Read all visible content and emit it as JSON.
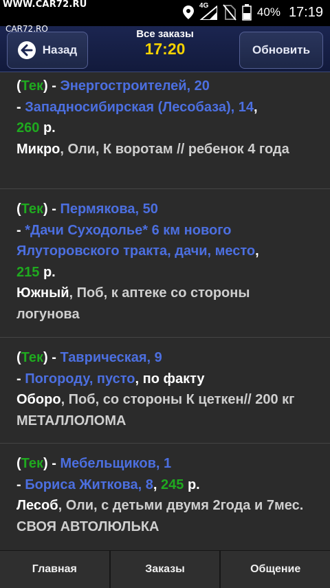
{
  "status_bar": {
    "watermark": "WWW.CAR72.RU",
    "battery": "40%",
    "time": "17:19",
    "network": "4G",
    "icons": [
      "location-icon",
      "signal-icon",
      "no-sim-icon",
      "battery-icon"
    ]
  },
  "toolbar": {
    "logo": "CAR72.RO",
    "back_label": "Назад",
    "title": "Все заказы",
    "clock": "17:20",
    "refresh_label": "Обновить"
  },
  "orders": [
    {
      "tag": "Тек",
      "from": "Энергостроителей, 20",
      "to": "Западносибирская (Лесобаза), 14",
      "to_extra": "",
      "price": "260",
      "currency": "р.",
      "district": "Микро",
      "note": ", Оли, К воротам // ребенок 4 года"
    },
    {
      "tag": "Тек",
      "from": "Пермякова, 50",
      "to": "*Дачи Суходолье* 6 км нового Ялуторовского тракта, дачи, место",
      "to_extra": "",
      "price": "215",
      "currency": "р.",
      "district": "Южный",
      "note": ", Поб, к аптеке со стороны логунова"
    },
    {
      "tag": "Тек",
      "from": "Таврическая, 9",
      "to": "Погороду, пусто",
      "to_extra": ", по факту",
      "price": "",
      "currency": "",
      "district": "Оборо",
      "note": ", Поб, со стороны К цеткен// 200 кг МЕТАЛЛОЛОМА"
    },
    {
      "tag": "Тек",
      "from": "Мебельщиков, 1",
      "to": "Бориса Житкова, 8",
      "to_extra": "",
      "price": "245",
      "currency": "р.",
      "district": "Лесоб",
      "note": ", Оли, с детьми двумя 2года и 7мес. СВОЯ АВТОЛЮЛЬКА"
    }
  ],
  "tabs": [
    "Главная",
    "Заказы",
    "Общение"
  ],
  "colors": {
    "tag": "#1faa1f",
    "address": "#4c6fe0",
    "clock": "#f5d200",
    "toolbar": "#1b2550"
  }
}
